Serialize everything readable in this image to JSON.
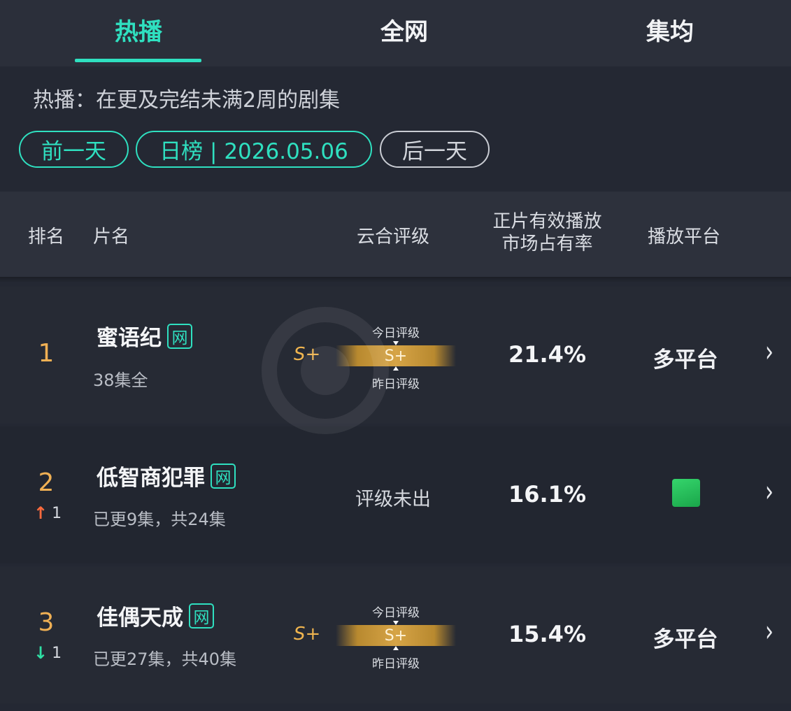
{
  "tabs": [
    {
      "label": "热播",
      "active": true
    },
    {
      "label": "全网",
      "active": false
    },
    {
      "label": "集均",
      "active": false
    }
  ],
  "description": "热播：在更及完结未满2周的剧集",
  "nav": {
    "prev_label": "前一天",
    "current_label": "日榜 | 2026.05.06",
    "next_label": "后一天"
  },
  "table_headers": {
    "rank": "排名",
    "title": "片名",
    "rating": "云合评级",
    "share_line1": "正片有效播放",
    "share_line2": "市场占有率",
    "platform": "播放平台"
  },
  "rows": [
    {
      "rank": "1",
      "title": "蜜语纪",
      "badge": "网",
      "episodes": "38集全",
      "rating_prefix": "S+",
      "rating_value": "S+",
      "rating_today_label": "今日评级",
      "rating_yesterday_label": "昨日评级",
      "share": "21.4%",
      "platform": "多平台"
    },
    {
      "rank": "2",
      "trend": "up",
      "trend_value": "1",
      "title": "低智商犯罪",
      "badge": "网",
      "episodes": "已更9集，共24集",
      "rating_pending": "评级未出",
      "share": "16.1%",
      "platform_icon": "platform-app-icon"
    },
    {
      "rank": "3",
      "trend": "down",
      "trend_value": "1",
      "title": "佳偶天成",
      "badge": "网",
      "episodes": "已更27集，共40集",
      "rating_prefix": "S+",
      "rating_value": "S+",
      "rating_today_label": "今日评级",
      "rating_yesterday_label": "昨日评级",
      "share": "15.4%",
      "platform": "多平台"
    }
  ],
  "colors": {
    "accent": "#2fe0c0",
    "rank": "#f0b054",
    "up": "#ff6b3d",
    "down": "#2fe0a5"
  }
}
